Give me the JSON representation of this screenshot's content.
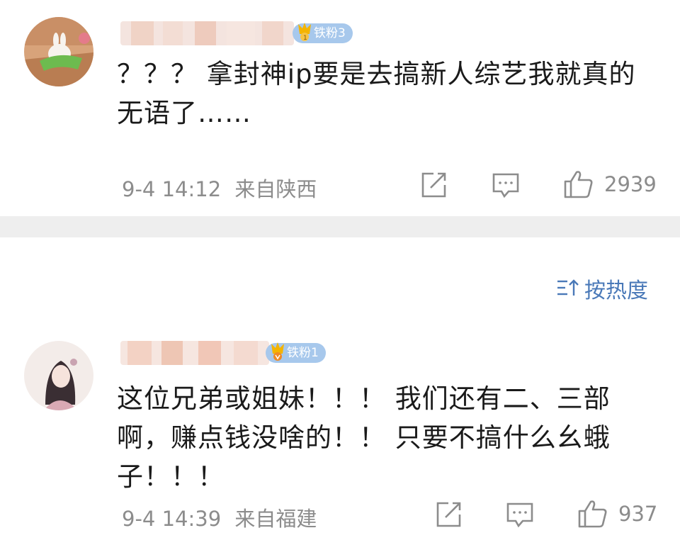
{
  "comments": [
    {
      "badge": "铁粉3",
      "text_lines": [
        "？？？ 拿封神ip要是去搞新人综艺我就真的",
        "无语了……"
      ],
      "date": "9-4 14:12",
      "location": "来自陕西",
      "likes": "2939",
      "icons": {
        "share": "share-icon",
        "reply": "comment-icon",
        "like": "thumbs-up-icon"
      }
    },
    {
      "badge": "铁粉1",
      "text_lines": [
        "这位兄弟或姐妹！！！ 我们还有二、三部",
        "啊，赚点钱没啥的！！ 只要不搞什么幺蛾",
        "子！！！"
      ],
      "date": "9-4 14:39",
      "location": "来自福建",
      "likes": "937",
      "icons": {
        "share": "share-icon",
        "reply": "comment-icon",
        "like": "thumbs-up-icon"
      }
    }
  ],
  "sort": {
    "label": "按热度",
    "icon": "sort-icon"
  },
  "colors": {
    "meta_gray": "#8c8c8c",
    "badge_blue": "#a7c8ec",
    "link_blue": "#4a79b8",
    "divider": "#eeeeee"
  }
}
